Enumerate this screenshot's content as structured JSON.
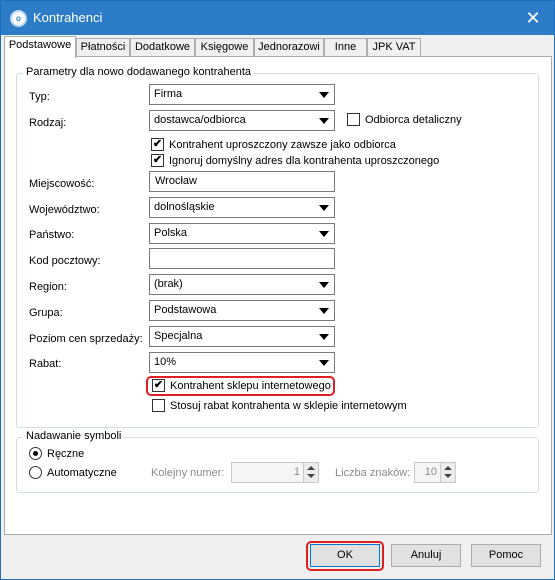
{
  "window": {
    "title": "Kontrahenci",
    "app_icon": "comarch-logo-icon",
    "close_symbol": "✕"
  },
  "tabs": [
    {
      "label": "Podstawowe",
      "active": true
    },
    {
      "label": "Płatności"
    },
    {
      "label": "Dodatkowe"
    },
    {
      "label": "Księgowe"
    },
    {
      "label": "Jednorazowi"
    },
    {
      "label": "Inne"
    },
    {
      "label": "JPK VAT"
    }
  ],
  "params": {
    "legend": "Parametry dla nowo dodawanego kontrahenta",
    "typ": {
      "label": "Typ:",
      "value": "Firma"
    },
    "rodzaj": {
      "label": "Rodzaj:",
      "value": "dostawca/odbiorca"
    },
    "odbiorca_detaliczny": {
      "label": "Odbiorca detaliczny",
      "checked": false
    },
    "uproszczony": {
      "label": "Kontrahent uproszczony zawsze jako odbiorca",
      "checked": true
    },
    "ignoruj_adres": {
      "label": "Ignoruj domyślny adres dla kontrahenta uproszczonego",
      "checked": true
    },
    "miejscowosc": {
      "label": "Miejscowość:",
      "value": "Wrocław"
    },
    "wojewodztwo": {
      "label": "Województwo:",
      "value": "dolnośląskie"
    },
    "panstwo": {
      "label": "Państwo:",
      "value": "Polska"
    },
    "kod_pocztowy": {
      "label": "Kod pocztowy:",
      "value": ""
    },
    "region": {
      "label": "Region:",
      "value": "(brak)"
    },
    "grupa": {
      "label": "Grupa:",
      "value": "Podstawowa"
    },
    "poziom_cen": {
      "label": "Poziom cen sprzedaży:",
      "value": "Specjalna"
    },
    "rabat": {
      "label": "Rabat:",
      "value": "10%"
    },
    "sklep_internetowy": {
      "label": "Kontrahent sklepu internetowego",
      "checked": true
    },
    "stosuj_rabat": {
      "label": "Stosuj rabat kontrahenta w sklepie internetowym",
      "checked": false
    },
    "check_mark": "✔"
  },
  "symbols": {
    "legend": "Nadawanie symboli",
    "reczne": {
      "label": "Ręczne",
      "selected": true
    },
    "automatyczne": {
      "label": "Automatyczne",
      "selected": false
    },
    "kolejny_numer": {
      "label": "Kolejny numer:",
      "value": "1"
    },
    "liczba_znakow": {
      "label": "Liczba znaków:",
      "value": "10"
    }
  },
  "buttons": {
    "ok": "OK",
    "cancel": "Anuluj",
    "help": "Pomoc"
  },
  "colors": {
    "title_bar": "#2d7cc7",
    "highlight": "#e02020"
  }
}
